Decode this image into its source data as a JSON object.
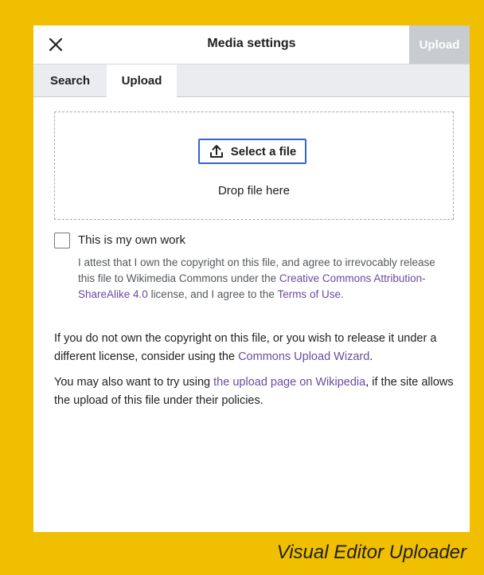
{
  "dialog": {
    "title": "Media settings",
    "upload_button": "Upload"
  },
  "tabs": [
    {
      "label": "Search"
    },
    {
      "label": "Upload"
    }
  ],
  "dropzone": {
    "select_button": "Select a file",
    "drop_text": "Drop file here"
  },
  "own_work": {
    "label": "This is my own work",
    "attest_pre": "I attest that I own the copyright on this file, and agree to irrevocably release this file to Wikimedia Commons under the ",
    "license_link": "Creative Commons Attribution-ShareAlike 4.0",
    "attest_mid": " license, and I agree to the ",
    "terms_link": "Terms of Use",
    "attest_end": "."
  },
  "info": {
    "para1_pre": "If you do not own the copyright on this file, or you wish to release it under a different license, consider using the ",
    "wizard_link": "Commons Upload Wizard",
    "para1_end": ".",
    "para2_pre": "You may also want to try using ",
    "wikipedia_link": "the upload page on Wikipedia",
    "para2_end": ", if the site allows the upload of this file under their policies."
  },
  "caption": "Visual Editor Uploader",
  "colors": {
    "background": "#f0bf00",
    "progressive": "#3366cc",
    "link": "#6b4ba1",
    "disabled": "#c8ccd1"
  }
}
